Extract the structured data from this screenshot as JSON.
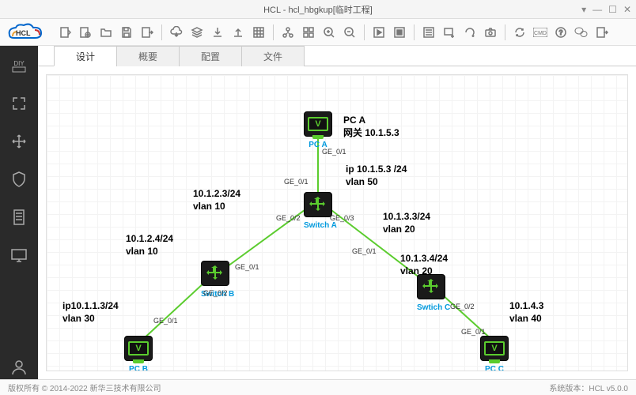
{
  "title": "HCL - hcl_hbgkup[临时工程]",
  "tabs": {
    "t0": "设计",
    "t1": "概要",
    "t2": "配置",
    "t3": "文件"
  },
  "nodes": {
    "pcA": "PC A",
    "pcB": "PC B",
    "pcC": "PC C",
    "swA": "Switch A",
    "swB": "Switch B",
    "swC": "Swtich C"
  },
  "ann": {
    "a1": "PC A\n网关 10.1.5.3",
    "a2": "ip 10.1.5.3 /24\nvlan 50",
    "a3": "10.1.2.3/24\nvlan 10",
    "a4": "10.1.2.4/24\nvlan 10",
    "a5": "10.1.3.3/24\nvlan 20",
    "a6": "10.1.3.4/24\nvlan 20",
    "a7": "ip10.1.1.3/24\nvlan 30",
    "a8": "10.1.4.3\nvlan 40"
  },
  "ports": {
    "p1": "GE_0/1",
    "p2": "GE_0/1",
    "p3": "GE_0/2",
    "p4": "GE_0/3",
    "p5": "GE_0/1",
    "p6": "GE_0/2",
    "p7": "GE_0/1",
    "p8": "GE_0/1",
    "p9": "GE_0/2",
    "p10": "GE_0/1"
  },
  "footer": {
    "copy": "版权所有 © 2014-2022 新华三技术有限公司",
    "ver": "系统版本：HCL v5.0.0"
  }
}
